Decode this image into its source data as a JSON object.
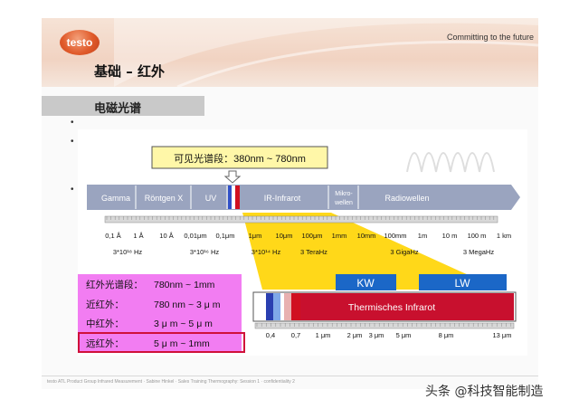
{
  "header": {
    "logo_text": "testo",
    "tagline": "Committing to the future",
    "title": "基础 – 红外"
  },
  "section": {
    "title": "电磁光谱"
  },
  "bullets": [
    "•",
    "•",
    "•"
  ],
  "visible_range_label": "可见光谱段：380nm ~ 780nm",
  "spectrum_bands": [
    "Gamma",
    "Röntgen X",
    "UV",
    "IR-Infrarot",
    "Mikro-",
    "wellen",
    "Radiowellen"
  ],
  "wavelength_ticks": [
    "0,1 Å",
    "1 Å",
    "10 Å",
    "0,01μm",
    "0,1μm",
    "1μm",
    "10μm",
    "100μm",
    "1mm",
    "10mm",
    "100mm",
    "1m",
    "10 m",
    "100 m",
    "1 km"
  ],
  "frequency_labels": [
    "3*10¹⁸ Hz",
    "3*10¹⁶ Hz",
    "3*10¹⁴ Hz",
    "3 TeraHz",
    "3 GigaHz",
    "3 MegaHz"
  ],
  "ir_ranges": [
    {
      "name": "红外光谱段：",
      "range": "780nm ~ 1mm"
    },
    {
      "name": "近红外：",
      "range": "780 nm ~ 3 μ m"
    },
    {
      "name": "中红外：",
      "range": "3 μ m ~ 5 μ m"
    },
    {
      "name": "远红外：",
      "range": "5 μ m ~ 1mm"
    }
  ],
  "ir_bands": {
    "kw": "KW",
    "lw": "LW",
    "thermal": "Thermisches Infrarot"
  },
  "ir_scale_ticks": [
    "0,4",
    "0,7",
    "1 μm",
    "2 μm",
    "3 μm",
    "5 μm",
    "8 μm",
    "13 μm"
  ],
  "footer": "testo  ATL Product Group Infrared Measurement · Sabine Hinkel · Sales Training Thermography: Session 1 · confidentiality 2",
  "watermark": "头条 @科技智能制造",
  "colors": {
    "band_fill": "#9aa4bf",
    "highlight_yellow": "#ffd400",
    "ir_box_pink": "#f27df2",
    "kw_lw_blue": "#1b67c7",
    "thermal_red": "#c8102e"
  }
}
